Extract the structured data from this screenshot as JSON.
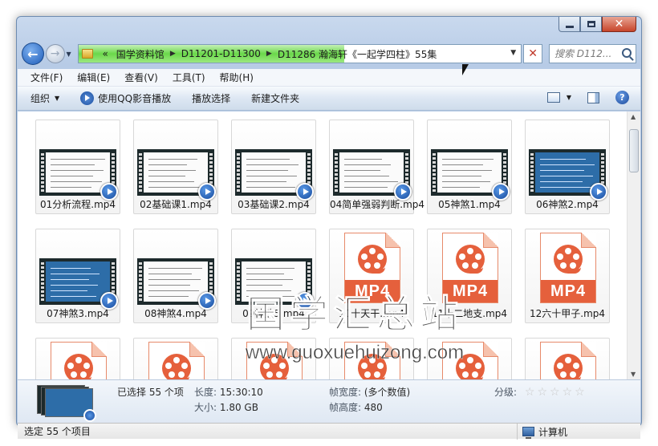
{
  "window": {
    "caption": {
      "minimize": "minimize",
      "maximize": "maximize",
      "close": "close"
    }
  },
  "navigation": {
    "address_progress": 0.6,
    "breadcrumbs": [
      "国学资料馆",
      "D11201-D11300",
      "D11286 瀚海轩《一起学四柱》55集"
    ],
    "overflow_glyph": "«",
    "search_placeholder": "搜索 D112..."
  },
  "menu": [
    "文件(F)",
    "编辑(E)",
    "查看(V)",
    "工具(T)",
    "帮助(H)"
  ],
  "commands": {
    "organize": "组织",
    "play_qq": "使用QQ影音播放",
    "play_selection": "播放选择",
    "new_folder": "新建文件夹"
  },
  "files": [
    {
      "name": "01分析流程.mp4",
      "kind": "video"
    },
    {
      "name": "02基础课1.mp4",
      "kind": "video"
    },
    {
      "name": "03基础课2.mp4",
      "kind": "video"
    },
    {
      "name": "04简单强弱判断.mp4",
      "kind": "video"
    },
    {
      "name": "05神煞1.mp4",
      "kind": "video"
    },
    {
      "name": "06神煞2.mp4",
      "kind": "video-dark"
    },
    {
      "name": "07神煞3.mp4",
      "kind": "video-dark"
    },
    {
      "name": "08神煞4.mp4",
      "kind": "video"
    },
    {
      "name": "09神煞5.mp4",
      "kind": "video"
    },
    {
      "name": "10十天干.mp4",
      "kind": "mp4-icon"
    },
    {
      "name": "11十二地支.mp4",
      "kind": "mp4-icon"
    },
    {
      "name": "12六十甲子.mp4",
      "kind": "mp4-icon"
    },
    {
      "name": "",
      "kind": "mp4-icon"
    },
    {
      "name": "",
      "kind": "mp4-icon"
    },
    {
      "name": "",
      "kind": "mp4-icon"
    },
    {
      "name": "",
      "kind": "mp4-icon"
    },
    {
      "name": "",
      "kind": "mp4-icon"
    },
    {
      "name": "",
      "kind": "mp4-icon"
    }
  ],
  "mp4_badge_text": "MP4",
  "watermark": {
    "text": "国学汇总站",
    "url": "www.guoxuehuizong.com"
  },
  "details": {
    "selected": "已选择 55 个项",
    "length_label": "长度:",
    "length_value": "15:30:10",
    "size_label": "大小:",
    "size_value": "1.80 GB",
    "frame_width_label": "帧宽度:",
    "frame_width_value": "(多个数值)",
    "frame_height_label": "帧高度:",
    "frame_height_value": "480",
    "rating_label": "分级:",
    "rating_value": 0,
    "rating_max": 5
  },
  "status": {
    "left": "选定 55 个项目",
    "right": "计算机"
  }
}
